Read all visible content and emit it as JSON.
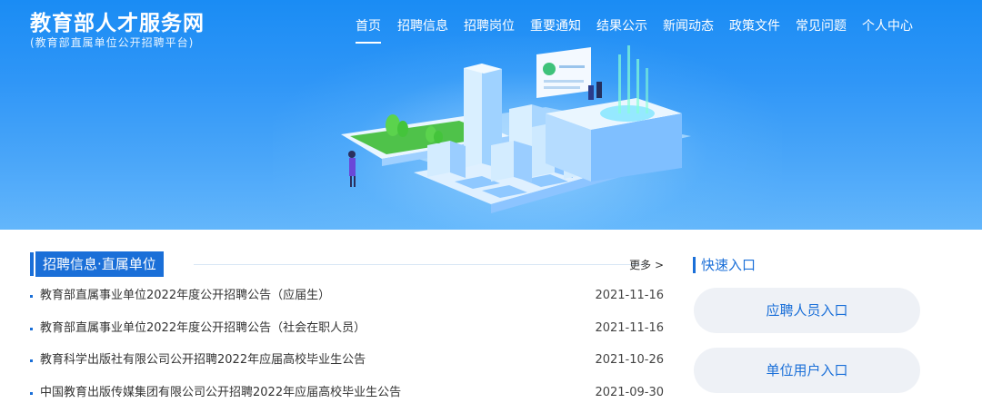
{
  "site": {
    "title": "教育部人才服务网",
    "subtitle": "(教育部直属单位公开招聘平台)"
  },
  "nav": {
    "items": [
      {
        "label": "首页",
        "active": true
      },
      {
        "label": "招聘信息",
        "active": false
      },
      {
        "label": "招聘岗位",
        "active": false
      },
      {
        "label": "重要通知",
        "active": false
      },
      {
        "label": "结果公示",
        "active": false
      },
      {
        "label": "新闻动态",
        "active": false
      },
      {
        "label": "政策文件",
        "active": false
      },
      {
        "label": "常见问题",
        "active": false
      },
      {
        "label": "个人中心",
        "active": false
      }
    ]
  },
  "recruit": {
    "title": "招聘信息·直属单位",
    "more_label": "更多 >",
    "items": [
      {
        "title": "教育部直属事业单位2022年度公开招聘公告（应届生）",
        "date": "2021-11-16"
      },
      {
        "title": "教育部直属事业单位2022年度公开招聘公告（社会在职人员）",
        "date": "2021-11-16"
      },
      {
        "title": "教育科学出版社有限公司公开招聘2022年应届高校毕业生公告",
        "date": "2021-10-26"
      },
      {
        "title": "中国教育出版传媒集团有限公司公开招聘2022年应届高校毕业生公告",
        "date": "2021-09-30"
      }
    ]
  },
  "quick": {
    "title": "快速入口",
    "applicant_label": "应聘人员入口",
    "employer_label": "单位用户入口"
  },
  "colors": {
    "accent": "#1a6fd8",
    "banner_top": "#1a8cf4",
    "banner_bottom": "#63b6fb",
    "button_bg": "#eef1f6"
  }
}
